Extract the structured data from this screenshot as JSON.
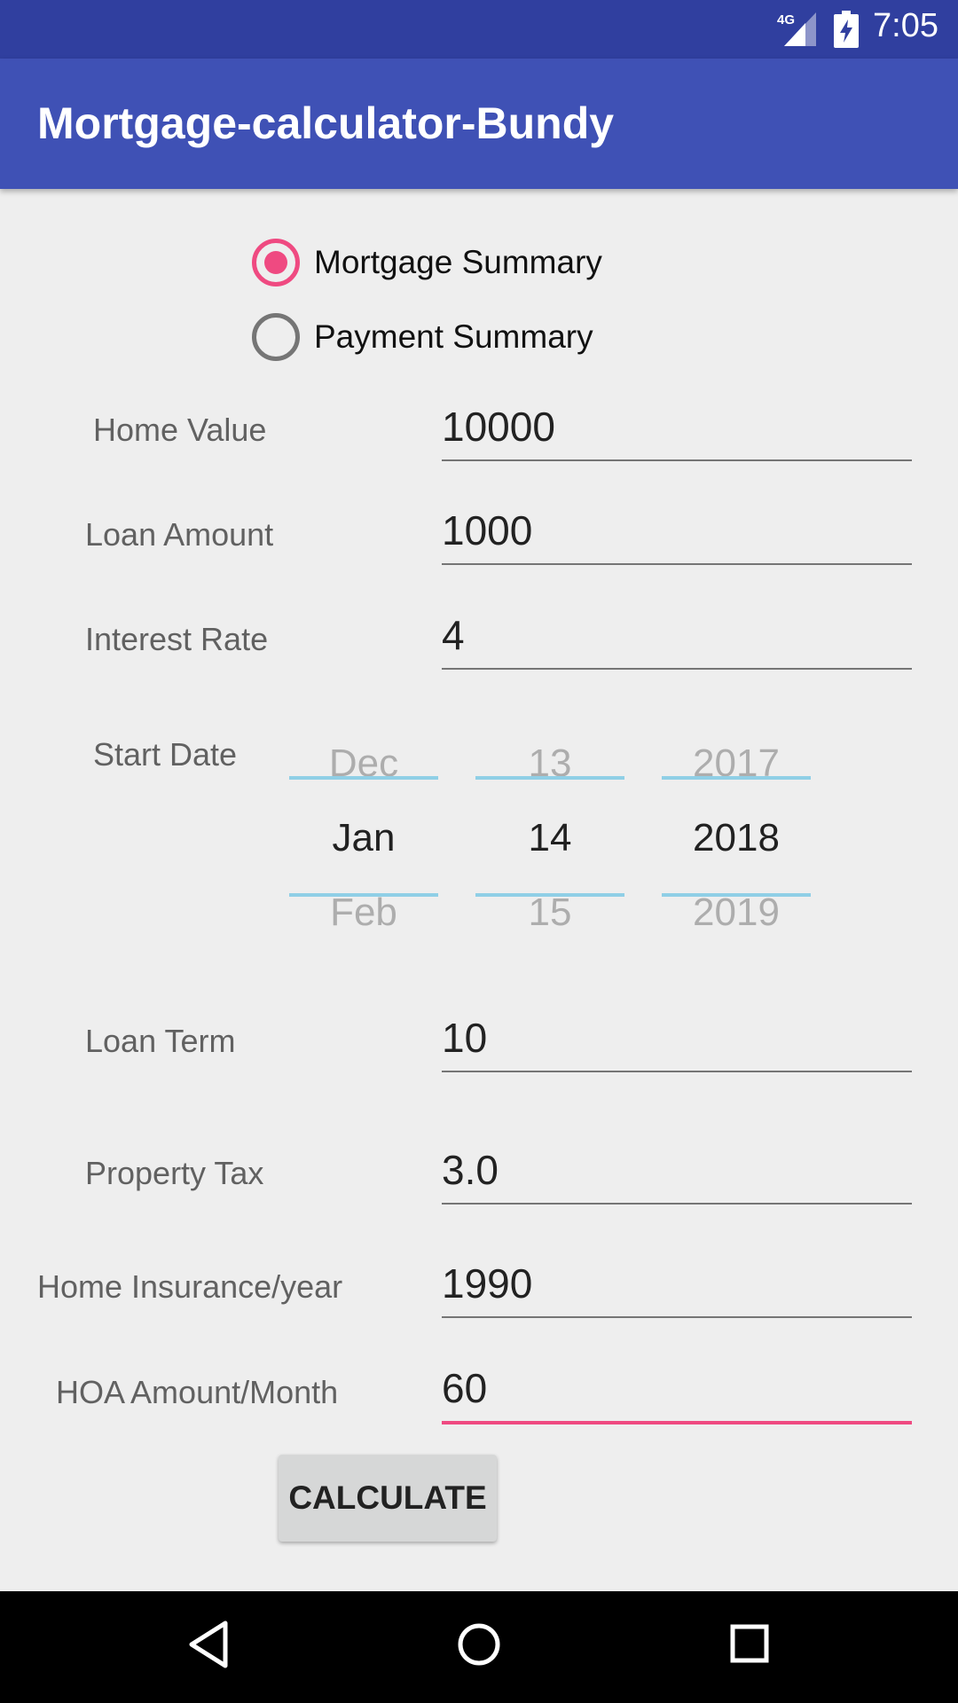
{
  "status_bar": {
    "network": "4G",
    "time": "7:05"
  },
  "app_bar": {
    "title": "Mortgage-calculator-Bundy"
  },
  "summary_options": [
    {
      "label": "Mortgage Summary",
      "selected": true
    },
    {
      "label": "Payment Summary",
      "selected": false
    }
  ],
  "fields": {
    "home_value": {
      "label": "Home Value",
      "value": "10000"
    },
    "loan_amount": {
      "label": "Loan Amount",
      "value": "1000"
    },
    "interest_rate": {
      "label": "Interest Rate",
      "value": "4"
    },
    "loan_term": {
      "label": "Loan Term",
      "value": "10"
    },
    "property_tax": {
      "label": "Property Tax",
      "value": "3.0"
    },
    "home_insurance": {
      "label": "Home Insurance/year",
      "value": "1990"
    },
    "hoa_amount": {
      "label": "HOA Amount/Month",
      "value": "60"
    }
  },
  "start_date": {
    "label": "Start Date",
    "month": {
      "prev": "Dec",
      "current": "Jan",
      "next": "Feb"
    },
    "day": {
      "prev": "13",
      "current": "14",
      "next": "15"
    },
    "year": {
      "prev": "2017",
      "current": "2018",
      "next": "2019"
    }
  },
  "calculate_button": {
    "label": "CALCULATE"
  },
  "colors": {
    "status_bar": "#303f9f",
    "app_bar": "#3f51b5",
    "accent": "#ef4a81",
    "picker_divider": "#8fcfe6",
    "background": "#eeeeee"
  },
  "nav_icons": [
    "back-icon",
    "home-icon",
    "recents-icon"
  ]
}
